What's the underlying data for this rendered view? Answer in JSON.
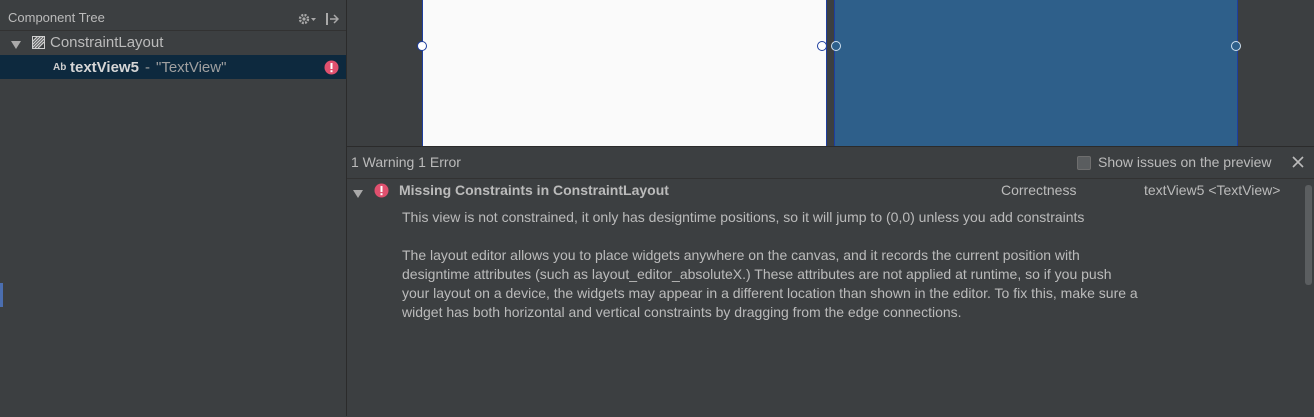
{
  "component_tree": {
    "title": "Component Tree",
    "root": {
      "label": "ConstraintLayout",
      "icon": "constraint-layout-icon"
    },
    "child": {
      "type_badge": "Ab",
      "name": "textView5",
      "separator": "-",
      "description": "\"TextView\"",
      "status": "error"
    }
  },
  "issues": {
    "summary": "1 Warning 1 Error",
    "show_preview_label": "Show issues on the preview",
    "issue": {
      "title": "Missing Constraints in ConstraintLayout",
      "category": "Correctness",
      "source": "textView5 <TextView>",
      "paragraph1": "This view is not constrained, it only has designtime positions, so it will jump to (0,0) unless you add constraints",
      "paragraph2": "The layout editor allows you to place widgets anywhere on the canvas, and it records the current position with designtime attributes (such as layout_editor_absoluteX.) These attributes are not applied at runtime, so if you push your layout on a device, the widgets may appear in a different location than shown in the editor. To fix this, make sure a widget has both horizontal and vertical constraints by dragging from the edge connections."
    }
  },
  "colors": {
    "background": "#3c3f41",
    "selection": "#0d293e",
    "error": "#e0506e",
    "blueprint_blue": "#2e5f8a",
    "blueprint_white": "#fafafa"
  }
}
